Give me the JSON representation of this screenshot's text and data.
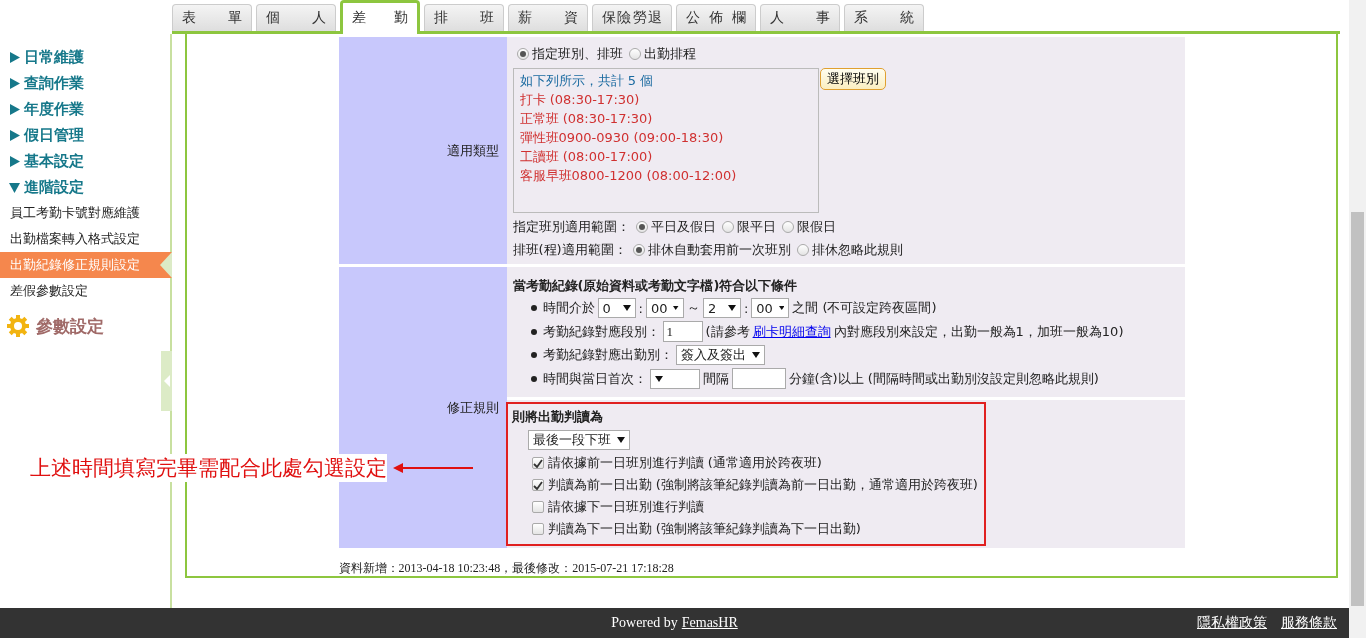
{
  "tabs": [
    {
      "label": "表單",
      "selected": false
    },
    {
      "label": "個人",
      "selected": false
    },
    {
      "label": "差勤",
      "selected": true
    },
    {
      "label": "排班",
      "selected": false
    },
    {
      "label": "薪資",
      "selected": false
    },
    {
      "label": "保險勞退",
      "selected": false
    },
    {
      "label": "公佈欄",
      "selected": false
    },
    {
      "label": "人事",
      "selected": false
    },
    {
      "label": "系統",
      "selected": false
    }
  ],
  "sidebar": {
    "menu": [
      {
        "label": "日常維護",
        "expanded": false
      },
      {
        "label": "查詢作業",
        "expanded": false
      },
      {
        "label": "年度作業",
        "expanded": false
      },
      {
        "label": "假日管理",
        "expanded": false
      },
      {
        "label": "基本設定",
        "expanded": false
      },
      {
        "label": "進階設定",
        "expanded": true,
        "children": [
          {
            "label": "員工考勤卡號對應維護",
            "selected": false
          },
          {
            "label": "出勤檔案轉入格式設定",
            "selected": false
          },
          {
            "label": "出勤紀錄修正規則設定",
            "selected": true
          },
          {
            "label": "差假參數設定",
            "selected": false
          }
        ]
      }
    ],
    "group_heading": "參數設定"
  },
  "shift_type": {
    "label": "適用類型",
    "options": [
      {
        "label": "指定班別、排班",
        "selected": true
      },
      {
        "label": "出勤排程",
        "selected": false
      }
    ],
    "summary": "如下列所示，共計 5 個",
    "shifts": [
      "打卡 (08:30-17:30)",
      "正常班 (08:30-17:30)",
      "彈性班0900-0930 (09:00-18:30)",
      "工讀班 (08:00-17:00)",
      "客服早班0800-1200 (08:00-12:00)"
    ],
    "select_button": "選擇班別",
    "scope": {
      "label": "指定班別適用範圍：",
      "options": [
        {
          "label": "平日及假日",
          "selected": true
        },
        {
          "label": "限平日",
          "selected": false
        },
        {
          "label": "限假日",
          "selected": false
        }
      ]
    },
    "schedule_scope": {
      "label": "排班(程)適用範圍：",
      "options": [
        {
          "label": "排休自動套用前一次班別",
          "selected": true
        },
        {
          "label": "排休忽略此規則",
          "selected": false
        }
      ]
    }
  },
  "rule": {
    "label": "修正規則",
    "conditions_title": "當考勤紀錄(原始資料或考勤文字檔)符合以下條件",
    "time_range": {
      "label": "時間介於",
      "from_hour": "0",
      "colon": ":",
      "from_minute": "00",
      "separator": "～",
      "to_hour": "2",
      "to_minute": "00",
      "suffix": "之間 (不可設定跨夜區間)"
    },
    "segment": {
      "label": "考勤紀錄對應段別：",
      "value": "1",
      "note_before": "(請參考",
      "link": "刷卡明細查詢",
      "note_after": "內對應段別來設定，出勤一般為1，加班一般為10)"
    },
    "attendance_type": {
      "label": "考勤紀錄對應出勤別：",
      "value": "簽入及簽出"
    },
    "interval": {
      "label": "時間與當日首次：",
      "gap_label": "間隔",
      "suffix": "分鐘(含)以上 (間隔時間或出勤別沒設定則忽略此規則)"
    },
    "result": {
      "title": "則將出勤判讀為",
      "value": "最後一段下班",
      "options": [
        {
          "label": "請依據前一日班別進行判讀 (通常適用於跨夜班)",
          "checked": true
        },
        {
          "label": "判讀為前一日出勤 (強制將該筆紀錄判讀為前一日出勤，通常適用於跨夜班)",
          "checked": true
        },
        {
          "label": "請依據下一日班別進行判讀",
          "checked": false
        },
        {
          "label": "判讀為下一日出勤 (強制將該筆紀錄判讀為下一日出勤)",
          "checked": false
        }
      ]
    }
  },
  "record_info": "資料新增：2013-04-18 10:23:48，最後修改：2015-07-21 17:18:28",
  "annotation": "上述時間填寫完畢需配合此處勾選設定",
  "footer": {
    "powered_by": "Powered by",
    "brand": "FemasHR",
    "links": [
      "隱私權政策",
      "服務條款"
    ]
  }
}
